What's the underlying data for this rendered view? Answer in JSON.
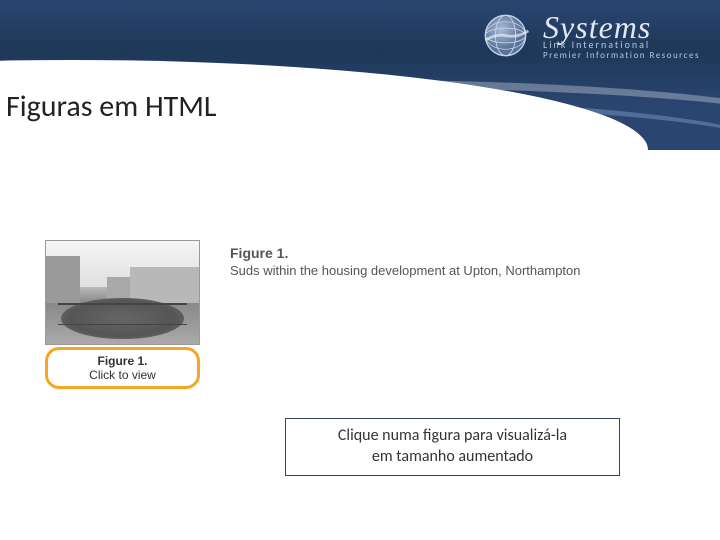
{
  "header": {
    "logo": {
      "main": "Systems",
      "sub1": "Link International",
      "sub2": "Premier Information Resources"
    }
  },
  "title": "Figuras em HTML",
  "figure": {
    "thumb_label": "Figure 1.",
    "click_label": "Click to view",
    "desc_title": "Figure 1.",
    "desc_text": "Suds within the housing development at Upton, Northampton"
  },
  "instruction": {
    "line1": "Clique numa figura para visualizá-la",
    "line2": "em tamanho aumentado"
  }
}
